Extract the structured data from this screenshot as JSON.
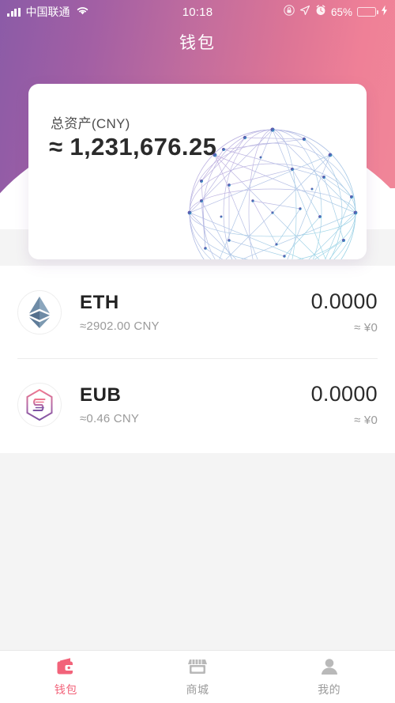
{
  "status_bar": {
    "signal_icon": "signal-bars-icon",
    "carrier": "中国联通",
    "wifi_icon": "wifi-icon",
    "time": "10:18",
    "rotation_lock_icon": "rotation-lock-icon",
    "location_icon": "location-arrow-icon",
    "alarm_icon": "alarm-clock-icon",
    "battery_percent": "65%",
    "battery_icon": "battery-icon",
    "charging_icon": "lightning-bolt-icon"
  },
  "header": {
    "title": "钱包",
    "gradient_start": "#8b5ba7",
    "gradient_end": "#f08798"
  },
  "balance_card": {
    "label": "总资产(CNY)",
    "value": "≈ 1,231,676.25",
    "graphic": "wireframe-globe-network"
  },
  "assets": [
    {
      "icon": "ethereum-icon",
      "symbol": "ETH",
      "price": "≈2902.00 CNY",
      "balance": "0.0000",
      "fiat": "≈ ¥0"
    },
    {
      "icon": "eub-hexagon-icon",
      "symbol": "EUB",
      "price": "≈0.46 CNY",
      "balance": "0.0000",
      "fiat": "≈ ¥0"
    }
  ],
  "tabbar": {
    "active_color": "#f2637a",
    "inactive_color": "#9b9b9b",
    "items": [
      {
        "icon": "wallet-icon",
        "label": "钱包",
        "active": true
      },
      {
        "icon": "store-icon",
        "label": "商城",
        "active": false
      },
      {
        "icon": "person-icon",
        "label": "我的",
        "active": false
      }
    ]
  }
}
